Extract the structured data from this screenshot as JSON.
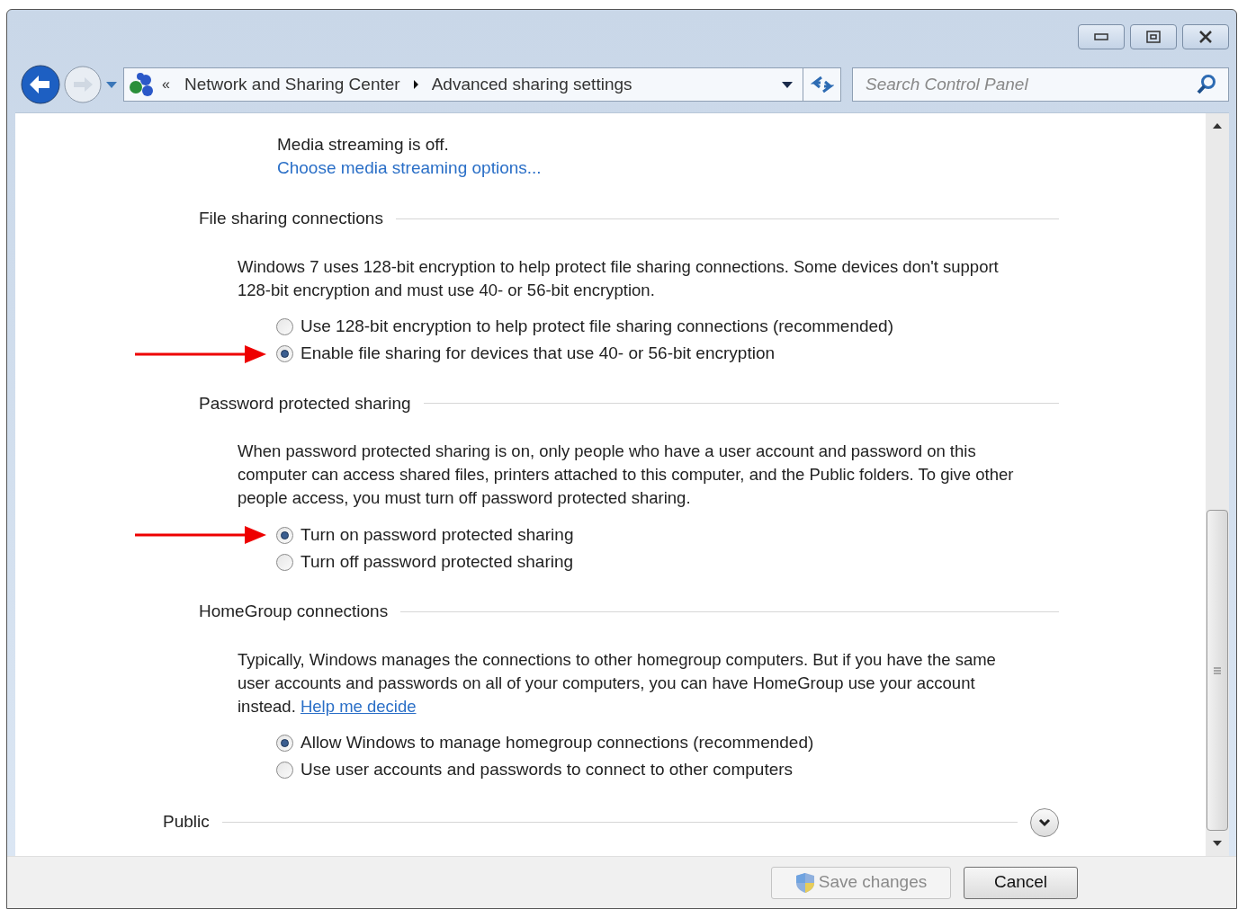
{
  "address_bar": {
    "overflow": "«",
    "breadcrumbs": [
      "Network and Sharing Center",
      "Advanced sharing settings"
    ]
  },
  "search": {
    "placeholder": "Search Control Panel"
  },
  "media": {
    "status": "Media streaming is off.",
    "link": "Choose media streaming options..."
  },
  "sections": [
    {
      "title": "File sharing connections",
      "description": "Windows 7 uses 128-bit encryption to help protect file sharing connections. Some devices don't support 128-bit encryption and must use 40- or 56-bit encryption.",
      "options": [
        {
          "label": "Use 128-bit encryption to help protect file sharing connections (recommended)",
          "selected": false,
          "arrow": false
        },
        {
          "label": "Enable file sharing for devices that use 40- or 56-bit encryption",
          "selected": true,
          "arrow": true
        }
      ]
    },
    {
      "title": "Password protected sharing",
      "description": "When password protected sharing is on, only people who have a user account and password on this computer can access shared files, printers attached to this computer, and the Public folders. To give other people access, you must turn off password protected sharing.",
      "options": [
        {
          "label": "Turn on password protected sharing",
          "selected": true,
          "arrow": true
        },
        {
          "label": "Turn off password protected sharing",
          "selected": false,
          "arrow": false
        }
      ]
    },
    {
      "title": "HomeGroup connections",
      "description": "Typically, Windows manages the connections to other homegroup computers. But if you have the same user accounts and passwords on all of your computers, you can have HomeGroup use your account instead.",
      "link": "Help me decide",
      "options": [
        {
          "label": "Allow Windows to manage homegroup connections (recommended)",
          "selected": true,
          "arrow": false
        },
        {
          "label": "Use user accounts and passwords to connect to other computers",
          "selected": false,
          "arrow": false
        }
      ]
    }
  ],
  "profile": {
    "title": "Public",
    "expanded": false
  },
  "buttons": [
    {
      "label": "Save changes",
      "disabled": true
    },
    {
      "label": "Cancel",
      "disabled": false
    }
  ]
}
